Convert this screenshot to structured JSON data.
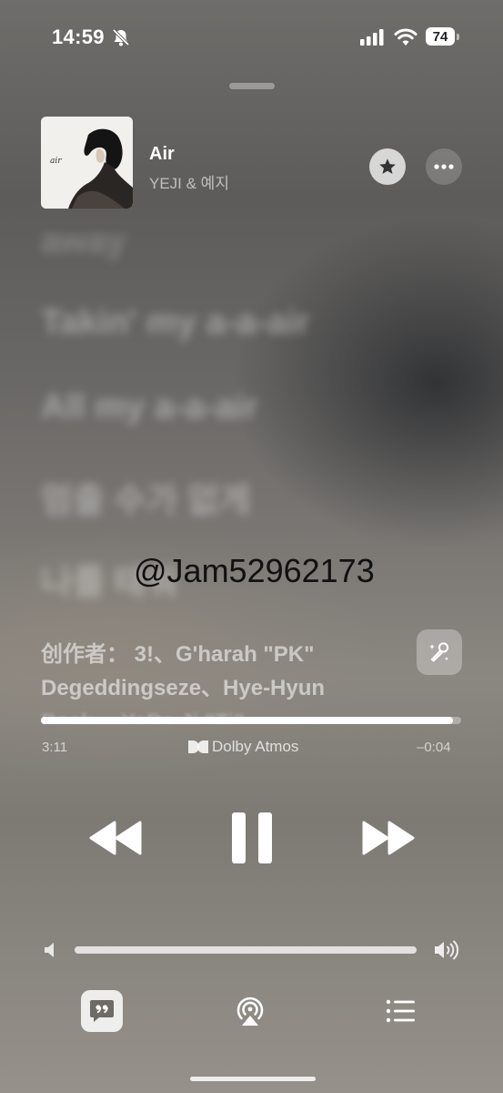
{
  "status_bar": {
    "time": "14:59",
    "battery_level": "74",
    "icons": [
      "bell-slash-icon",
      "cellular-signal-icon",
      "wifi-icon",
      "battery-icon"
    ]
  },
  "now_playing": {
    "title": "Air",
    "artist": "YEJI & 예지",
    "artwork_text": "air"
  },
  "lyrics": {
    "lines": [
      "away",
      "Takin' my a-a-air",
      "All my a-a-air",
      "멈출 수가 없게",
      "나를 태워"
    ]
  },
  "watermark": "@Jam52962173",
  "credits": {
    "line1": "创作者：  3!、G'harah \"PK\"",
    "line2": "Degeddingseze、Hye-Hyun",
    "line3": "Baek、 YeDa Ji \"Ti\""
  },
  "playback": {
    "elapsed": "3:11",
    "remaining": "–0:04",
    "progress": 0.98,
    "format_label": "Dolby Atmos",
    "state": "playing"
  },
  "volume": {
    "level": 1.0
  },
  "colors": {
    "accent": "#ffffff",
    "watermark": "#111111"
  }
}
